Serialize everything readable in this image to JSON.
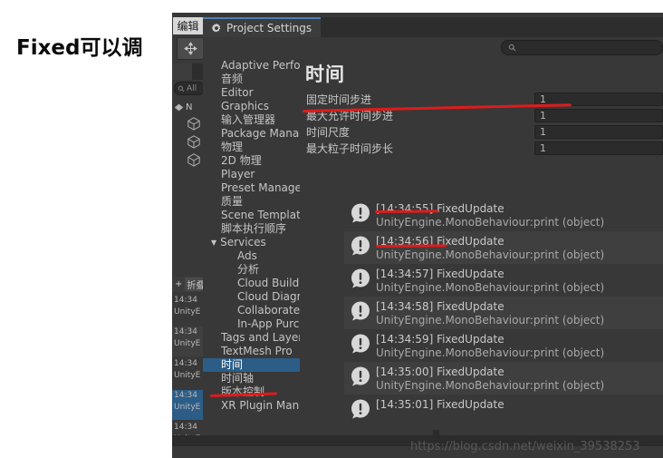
{
  "annotation": {
    "text": "Fixed可以调"
  },
  "editor": {
    "menu_edit": "编辑",
    "move_tool_icon": "move-tool-icon",
    "hierarchy_search_placeholder": "All",
    "hierarchy_scene_label": "N",
    "console_toolbar": {
      "clear_label": "+",
      "collapse_label": "折叠"
    },
    "background_logs": [
      {
        "time": "14:34",
        "source": "UnityE"
      },
      {
        "time": "14:34",
        "source": "UnityE"
      },
      {
        "time": "14:34",
        "source": "UnityE"
      },
      {
        "time": "14:34",
        "source": "UnityE"
      },
      {
        "time": "14:34",
        "source": "UnityE"
      }
    ]
  },
  "project_settings": {
    "tab_title": "Project Settings",
    "tab_icon": "gear-icon",
    "search": {
      "icon": "search-icon",
      "value": "",
      "placeholder": ""
    },
    "tree": [
      {
        "label": "Adaptive Performance",
        "level": "normal",
        "selected": false
      },
      {
        "label": "音频",
        "level": "normal",
        "selected": false
      },
      {
        "label": "Editor",
        "level": "normal",
        "selected": false
      },
      {
        "label": "Graphics",
        "level": "normal",
        "selected": false
      },
      {
        "label": "输入管理器",
        "level": "normal",
        "selected": false
      },
      {
        "label": "Package Manager",
        "level": "normal",
        "selected": false
      },
      {
        "label": "物理",
        "level": "normal",
        "selected": false
      },
      {
        "label": "2D 物理",
        "level": "normal",
        "selected": false
      },
      {
        "label": "Player",
        "level": "normal",
        "selected": false
      },
      {
        "label": "Preset Manager",
        "level": "normal",
        "selected": false
      },
      {
        "label": "质量",
        "level": "normal",
        "selected": false
      },
      {
        "label": "Scene Template",
        "level": "normal",
        "selected": false
      },
      {
        "label": "脚本执行顺序",
        "level": "normal",
        "selected": false
      },
      {
        "label": "Services",
        "level": "group",
        "expanded": true,
        "selected": false
      },
      {
        "label": "Ads",
        "level": "indent",
        "selected": false
      },
      {
        "label": "分析",
        "level": "indent",
        "selected": false
      },
      {
        "label": "Cloud Build",
        "level": "indent",
        "selected": false
      },
      {
        "label": "Cloud Diagnostics",
        "level": "indent",
        "selected": false
      },
      {
        "label": "Collaborate",
        "level": "indent",
        "selected": false
      },
      {
        "label": "In-App Purchasing",
        "level": "indent",
        "selected": false
      },
      {
        "label": "Tags and Layers",
        "level": "normal",
        "selected": false
      },
      {
        "label": "TextMesh Pro",
        "level": "normal",
        "selected": false
      },
      {
        "label": "时间",
        "level": "normal",
        "selected": true
      },
      {
        "label": "时间轴",
        "level": "normal",
        "selected": false
      },
      {
        "label": "版本控制",
        "level": "normal",
        "selected": false
      },
      {
        "label": "XR Plugin Management",
        "level": "normal",
        "selected": false
      }
    ],
    "page_title": "时间",
    "fields": [
      {
        "label": "固定时间步进",
        "value": "1"
      },
      {
        "label": "最大允许时间步进",
        "value": "1"
      },
      {
        "label": "时间尺度",
        "value": "1"
      },
      {
        "label": "最大粒子时间步长",
        "value": "1"
      }
    ]
  },
  "console": {
    "entry_icon": "warning-bubble-icon",
    "entries": [
      {
        "line1": "[14:34:55] FixedUpdate",
        "line2": "UnityEngine.MonoBehaviour:print (object)"
      },
      {
        "line1": "[14:34:56] FixedUpdate",
        "line2": "UnityEngine.MonoBehaviour:print (object)"
      },
      {
        "line1": "[14:34:57] FixedUpdate",
        "line2": "UnityEngine.MonoBehaviour:print (object)"
      },
      {
        "line1": "[14:34:58] FixedUpdate",
        "line2": "UnityEngine.MonoBehaviour:print (object)"
      },
      {
        "line1": "[14:34:59] FixedUpdate",
        "line2": "UnityEngine.MonoBehaviour:print (object)"
      },
      {
        "line1": "[14:35:00] FixedUpdate",
        "line2": "UnityEngine.MonoBehaviour:print (object)"
      },
      {
        "line1": "[14:35:01] FixedUpdate",
        "line2": ""
      }
    ]
  },
  "watermark": {
    "text": "https://blog.csdn.net/weixin_39538253"
  },
  "colors": {
    "accent_selection": "#2c5d87",
    "annotation_red": "#e01b1b",
    "panel_bg": "#383838",
    "tab_active_border": "#4b7fb5"
  }
}
